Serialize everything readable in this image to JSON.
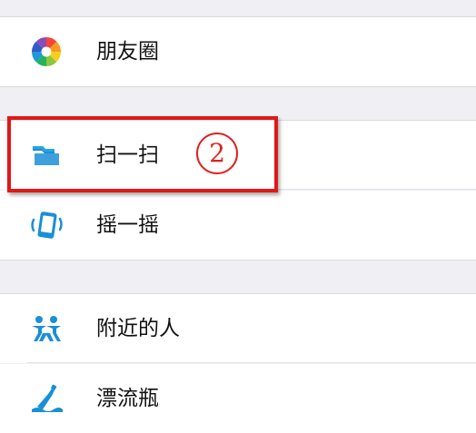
{
  "discover_menu": {
    "moments": {
      "label": "朋友圈",
      "icon": "moments-aperture-icon"
    },
    "scan": {
      "label": "扫一扫",
      "icon": "scan-icon"
    },
    "shake": {
      "label": "摇一摇",
      "icon": "shake-phone-icon"
    },
    "people_nearby": {
      "label": "附近的人",
      "icon": "people-nearby-icon"
    },
    "drift_bottle": {
      "label": "漂流瓶",
      "icon": "drift-bottle-icon"
    }
  },
  "annotation": {
    "step_number": "2",
    "highlight_color": "#e01818"
  },
  "colors": {
    "background": "#efeff4",
    "row": "#ffffff",
    "icon_blue": "#1a8fd6"
  }
}
